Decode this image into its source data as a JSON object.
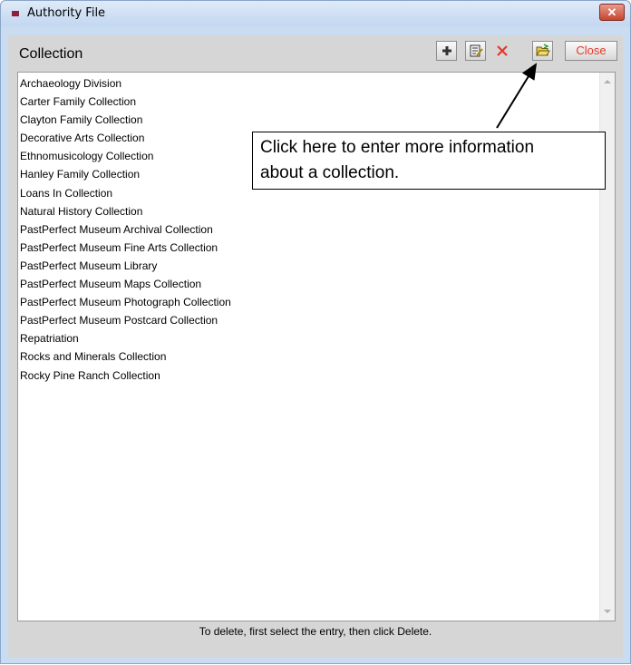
{
  "window": {
    "title": "Authority File",
    "close_glyph": "✕"
  },
  "header": {
    "label": "Collection"
  },
  "toolbar": {
    "add_icon": "plus-icon",
    "edit_icon": "notepad-icon",
    "delete_icon": "delete-x-icon",
    "open_icon": "open-folder-icon",
    "close_label": "Close"
  },
  "list": {
    "items": [
      "Archaeology Division",
      "Carter Family Collection",
      "Clayton Family Collection",
      "Decorative Arts Collection",
      "Ethnomusicology Collection",
      "Hanley Family Collection",
      "Loans In Collection",
      "Natural History Collection",
      "PastPerfect Museum Archival Collection",
      "PastPerfect Museum Fine Arts Collection",
      "PastPerfect Museum Library",
      "PastPerfect Museum Maps Collection",
      "PastPerfect Museum Photograph Collection",
      "PastPerfect Museum Postcard Collection",
      "Repatriation",
      "Rocks and Minerals Collection",
      "Rocky Pine Ranch Collection"
    ]
  },
  "status": {
    "text": "To delete, first select the entry, then click Delete."
  },
  "callout": {
    "line1": "Click here to enter more information",
    "line2": "about a collection."
  },
  "colors": {
    "close_text": "#e23a2b",
    "delete_icon": "#e23a2b",
    "title_icon": "#8b1f3c"
  }
}
